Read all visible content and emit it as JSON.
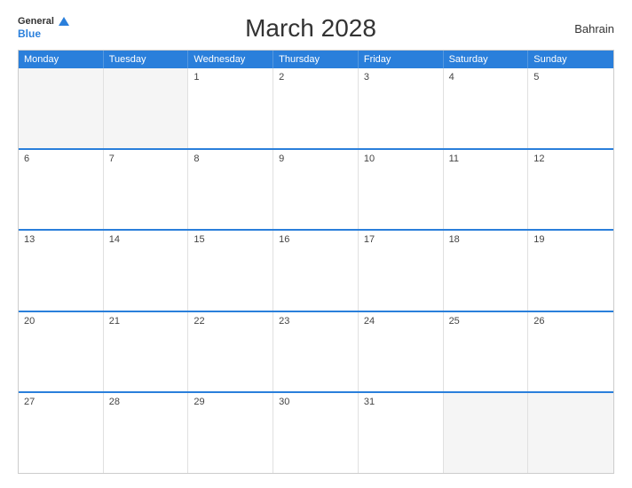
{
  "header": {
    "logo_line1": "General",
    "logo_line2": "Blue",
    "title": "March 2028",
    "country": "Bahrain"
  },
  "days_of_week": [
    "Monday",
    "Tuesday",
    "Wednesday",
    "Thursday",
    "Friday",
    "Saturday",
    "Sunday"
  ],
  "weeks": [
    [
      {
        "num": "",
        "empty": true
      },
      {
        "num": "",
        "empty": true
      },
      {
        "num": "1",
        "empty": false
      },
      {
        "num": "2",
        "empty": false
      },
      {
        "num": "3",
        "empty": false
      },
      {
        "num": "4",
        "empty": false
      },
      {
        "num": "5",
        "empty": false
      }
    ],
    [
      {
        "num": "6",
        "empty": false
      },
      {
        "num": "7",
        "empty": false
      },
      {
        "num": "8",
        "empty": false
      },
      {
        "num": "9",
        "empty": false
      },
      {
        "num": "10",
        "empty": false
      },
      {
        "num": "11",
        "empty": false
      },
      {
        "num": "12",
        "empty": false
      }
    ],
    [
      {
        "num": "13",
        "empty": false
      },
      {
        "num": "14",
        "empty": false
      },
      {
        "num": "15",
        "empty": false
      },
      {
        "num": "16",
        "empty": false
      },
      {
        "num": "17",
        "empty": false
      },
      {
        "num": "18",
        "empty": false
      },
      {
        "num": "19",
        "empty": false
      }
    ],
    [
      {
        "num": "20",
        "empty": false
      },
      {
        "num": "21",
        "empty": false
      },
      {
        "num": "22",
        "empty": false
      },
      {
        "num": "23",
        "empty": false
      },
      {
        "num": "24",
        "empty": false
      },
      {
        "num": "25",
        "empty": false
      },
      {
        "num": "26",
        "empty": false
      }
    ],
    [
      {
        "num": "27",
        "empty": false
      },
      {
        "num": "28",
        "empty": false
      },
      {
        "num": "29",
        "empty": false
      },
      {
        "num": "30",
        "empty": false
      },
      {
        "num": "31",
        "empty": false
      },
      {
        "num": "",
        "empty": true
      },
      {
        "num": "",
        "empty": true
      }
    ]
  ]
}
